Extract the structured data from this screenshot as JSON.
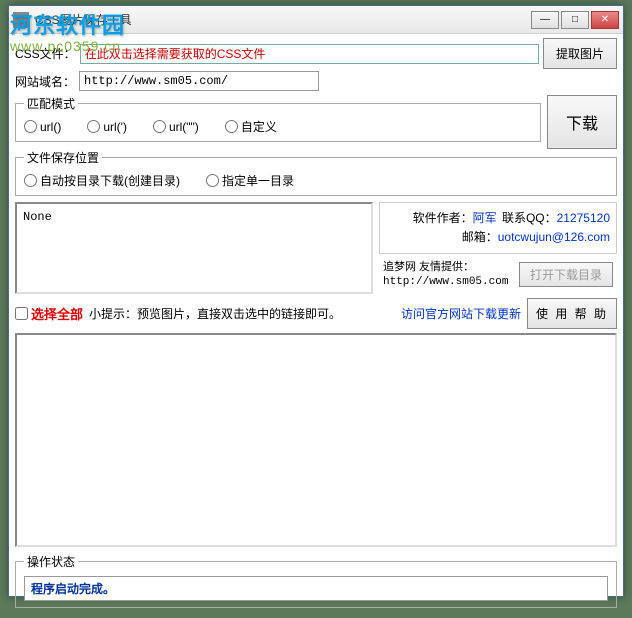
{
  "watermark": {
    "title": "河东软件园",
    "url": "www.pc0359.cn"
  },
  "window": {
    "title": "CSS图片保存工具"
  },
  "labels": {
    "cssfile": "CSS文件：",
    "domain": "网站域名："
  },
  "inputs": {
    "cssfile_placeholder": "在此双击选择需要获取的CSS文件",
    "domain_value": "http://www.sm05.com/"
  },
  "buttons": {
    "extract": "提取图片",
    "download": "下载",
    "open_dir": "打开下载目录",
    "help": "使 用 帮 助"
  },
  "match_mode": {
    "legend": "匹配模式",
    "options": [
      "url()",
      "url(')",
      "url(\"\")",
      "自定义"
    ]
  },
  "save_location": {
    "legend": "文件保存位置",
    "options": [
      "自动按目录下载(创建目录)",
      "指定单一目录"
    ]
  },
  "preview": {
    "text": "None"
  },
  "info": {
    "author_label": "软件作者：",
    "author_name": "阿军",
    "contact_label": "联系QQ：",
    "contact_value": "21275120",
    "email_label": "邮箱：",
    "email_value": "uotcwujun@126.com",
    "site_label": "追梦网 友情提供：",
    "site_url": "http://www.sm05.com"
  },
  "select_all": {
    "label": "选择全部",
    "hint_prefix": "小提示：",
    "hint": "预览图片，直接双击选中的链接即可。",
    "update_link": "访问官方网站下载更新"
  },
  "status": {
    "legend": "操作状态",
    "text": "程序启动完成。"
  }
}
